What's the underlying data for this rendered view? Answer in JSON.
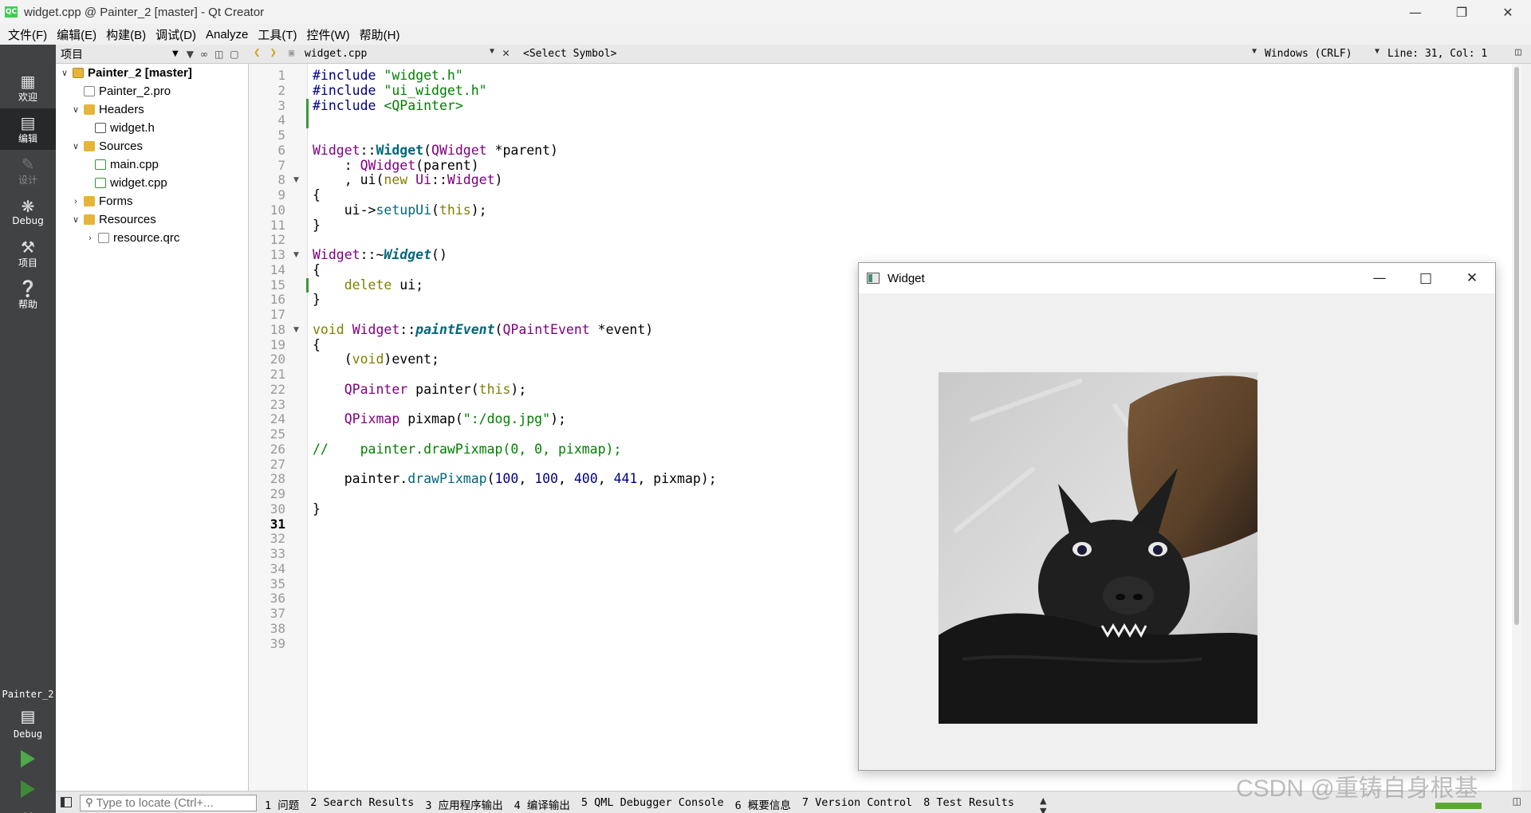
{
  "window": {
    "title": "widget.cpp @ Painter_2 [master] - Qt Creator",
    "app_icon": "QC"
  },
  "menu": [
    "文件(F)",
    "编辑(E)",
    "构建(B)",
    "调试(D)",
    "Analyze",
    "工具(T)",
    "控件(W)",
    "帮助(H)"
  ],
  "modes": [
    {
      "label": "欢迎",
      "icon": "grid-icon"
    },
    {
      "label": "编辑",
      "icon": "document-icon"
    },
    {
      "label": "设计",
      "icon": "pencil-icon"
    },
    {
      "label": "Debug",
      "icon": "bug-icon"
    },
    {
      "label": "项目",
      "icon": "wrench-icon"
    },
    {
      "label": "帮助",
      "icon": "help-icon"
    }
  ],
  "kit": {
    "project": "Painter_2",
    "build": "Debug"
  },
  "project_panel": {
    "header": "项目",
    "tree": [
      {
        "label": "Painter_2 [master]"
      },
      {
        "label": "Painter_2.pro"
      },
      {
        "label": "Headers"
      },
      {
        "label": "widget.h"
      },
      {
        "label": "Sources"
      },
      {
        "label": "main.cpp"
      },
      {
        "label": "widget.cpp"
      },
      {
        "label": "Forms"
      },
      {
        "label": "Resources"
      },
      {
        "label": "resource.qrc"
      }
    ]
  },
  "editor_toolbar": {
    "file": "widget.cpp",
    "symbol": "<Select Symbol>",
    "encoding": "Windows (CRLF)",
    "position": "Line: 31, Col: 1"
  },
  "editor": {
    "current_line": 31,
    "line_count": 39,
    "lines": [
      "#include \"widget.h\"",
      "#include \"ui_widget.h\"",
      "#include <QPainter>",
      "",
      "",
      "Widget::Widget(QWidget *parent)",
      "    : QWidget(parent)",
      "    , ui(new Ui::Widget)",
      "{",
      "    ui->setupUi(this);",
      "}",
      "",
      "Widget::~Widget()",
      "{",
      "    delete ui;",
      "}",
      "",
      "void Widget::paintEvent(QPaintEvent *event)",
      "{",
      "    (void)event;",
      "",
      "    QPainter painter(this);",
      "",
      "    QPixmap pixmap(\":/dog.jpg\");",
      "",
      "//    painter.drawPixmap(0, 0, pixmap);",
      "",
      "    painter.drawPixmap(100, 100, 400, 441, pixmap);",
      "",
      "}",
      ""
    ]
  },
  "widget_window": {
    "title": "Widget"
  },
  "statusbar": {
    "locator_placeholder": "Type to locate (Ctrl+...",
    "panes": [
      "1 问题",
      "2 Search Results",
      "3 应用程序输出",
      "4 编译输出",
      "5 QML Debugger Console",
      "6 概要信息",
      "7 Version Control",
      "8 Test Results"
    ]
  },
  "watermark": "CSDN @重铸自身根基"
}
